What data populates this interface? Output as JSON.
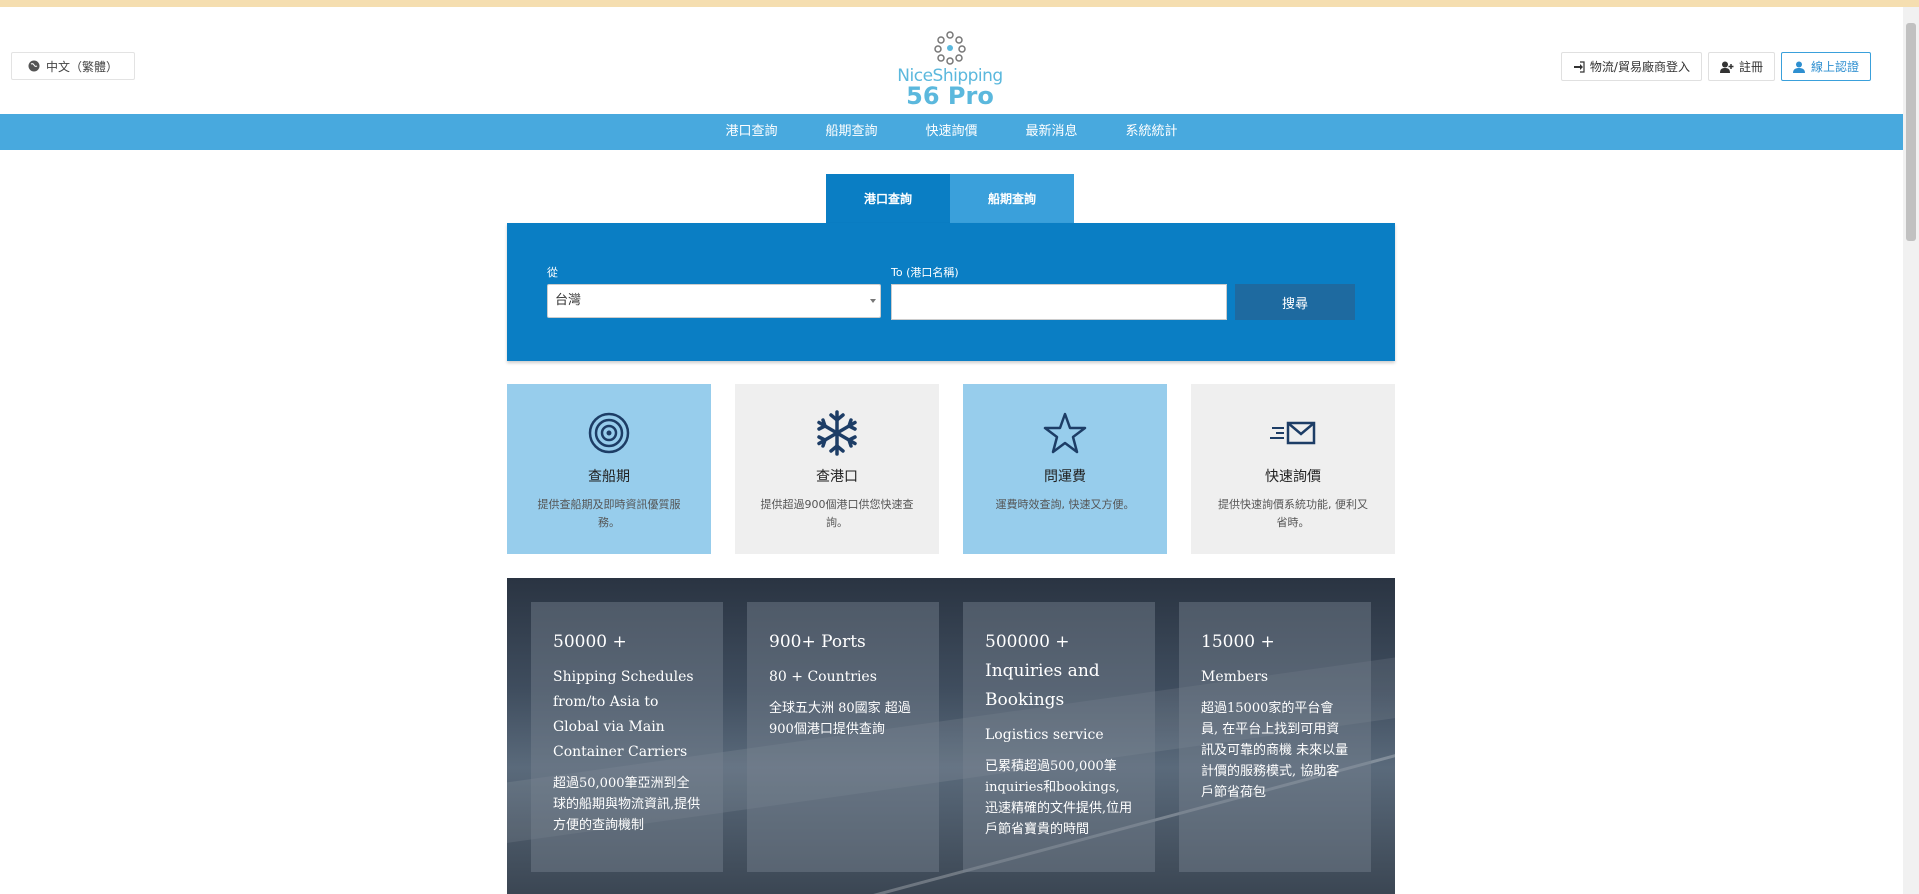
{
  "header": {
    "language": "中文（繁體）",
    "logo_line1": "NiceShipping",
    "logo_line2": "56 Pro",
    "buttons": [
      {
        "label": "物流/貿易廠商登入",
        "icon": "sign-in-icon"
      },
      {
        "label": "註冊",
        "icon": "user-plus-icon"
      },
      {
        "label": "線上認證",
        "icon": "user-certify-icon"
      }
    ]
  },
  "nav": {
    "items": [
      "港口查詢",
      "船期查詢",
      "快速詢價",
      "最新消息",
      "系統統計"
    ]
  },
  "search": {
    "tabs": [
      "港口查詢",
      "船期查詢"
    ],
    "from_label": "從",
    "from_value": "台灣",
    "to_label": "To (港口名稱)",
    "to_value": "",
    "search_button": "搜尋"
  },
  "features": [
    {
      "title": "查船期",
      "desc": "提供查船期及即時資訊優質服務。",
      "icon": "target-icon"
    },
    {
      "title": "查港口",
      "desc": "提供超過900個港口供您快速查詢。",
      "icon": "snowflake-icon"
    },
    {
      "title": "問運費",
      "desc": "運費時效查詢, 快速又方便。",
      "icon": "star-icon"
    },
    {
      "title": "快速詢價",
      "desc": "提供快速詢價系統功能, 便利又省時。",
      "icon": "fast-mail-icon"
    }
  ],
  "stats": [
    {
      "big": "50000 +",
      "sub": "Shipping Schedules from/to Asia to Global via Main Container Carriers",
      "txt": "超過50,000筆亞洲到全球的船期與物流資訊,提供方便的查詢機制"
    },
    {
      "big": "900+ Ports",
      "sub": "80 + Countries",
      "txt": "全球五大洲 80國家 超過900個港口提供查詢"
    },
    {
      "big": "500000 + Inquiries and Bookings",
      "sub": "Logistics service",
      "txt": "已累積超過500,000筆inquiries和bookings, 迅速精確的文件提供,位用戶節省寶貴的時間"
    },
    {
      "big": "15000 +",
      "sub": "Members",
      "txt": "超過15000家的平台會員, 在平台上找到可用資訊及可靠的商機 未來以量計價的服務模式, 協助客戶節省荷包"
    }
  ]
}
